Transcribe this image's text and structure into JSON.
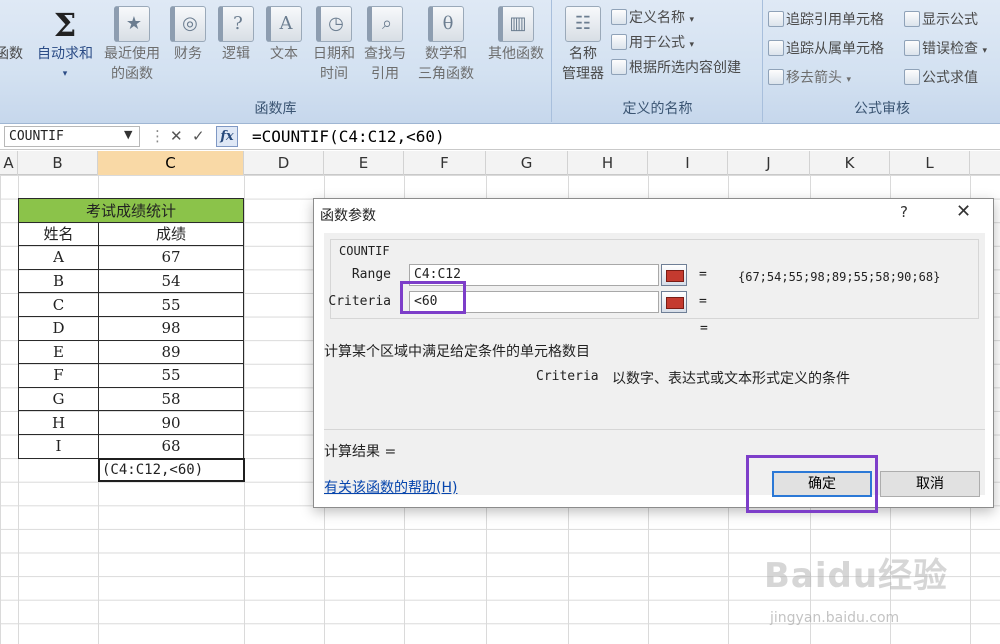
{
  "ribbon": {
    "groups": {
      "library": "函数库",
      "defined_names": "定义的名称",
      "auditing": "公式审核"
    },
    "insert_function_partial": "函数",
    "autosum": {
      "icon_glyph": "Σ",
      "label": "自动求和"
    },
    "recent": {
      "line1": "最近使用",
      "line2": "的函数"
    },
    "financial": "财务",
    "logical": "逻辑",
    "text": "文本",
    "datetime": {
      "line1": "日期和",
      "line2": "时间"
    },
    "lookup": {
      "line1": "查找与",
      "line2": "引用"
    },
    "math": {
      "line1": "数学和",
      "line2": "三角函数"
    },
    "more": "其他函数",
    "name_manager": {
      "line1": "名称",
      "line2": "管理器"
    },
    "define_name": "定义名称",
    "use_in_formula": "用于公式",
    "create_from_selection": "根据所选内容创建",
    "trace_precedents": "追踪引用单元格",
    "trace_dependents": "追踪从属单元格",
    "remove_arrows": "移去箭头",
    "show_formulas": "显示公式",
    "error_checking": "错误检查",
    "evaluate_formula": "公式求值"
  },
  "formula_bar": {
    "name_box": "COUNTIF",
    "formula": "=COUNTIF(C4:C12,<60)"
  },
  "columns": [
    "A",
    "B",
    "C",
    "D",
    "E",
    "F",
    "G",
    "H",
    "I",
    "J",
    "K",
    "L"
  ],
  "table": {
    "title": "考试成绩统计",
    "headers": [
      "姓名",
      "成绩"
    ],
    "rows": [
      [
        "A",
        "67"
      ],
      [
        "B",
        "54"
      ],
      [
        "C",
        "55"
      ],
      [
        "D",
        "98"
      ],
      [
        "E",
        "89"
      ],
      [
        "F",
        "55"
      ],
      [
        "G",
        "58"
      ],
      [
        "H",
        "90"
      ],
      [
        "I",
        "68"
      ]
    ],
    "edit_cell": "(C4:C12,<60)"
  },
  "dialog": {
    "title": "函数参数",
    "help_glyph": "?",
    "close_glyph": "✕",
    "function_name": "COUNTIF",
    "range_label": "Range",
    "range_value": "C4:C12",
    "range_result": "{67;54;55;98;89;55;58;90;68}",
    "criteria_label": "Criteria",
    "criteria_value": "<60",
    "eq": "=",
    "description": "计算某个区域中满足给定条件的单元格数目",
    "arg_desc_name": "Criteria",
    "arg_desc": "以数字、表达式或文本形式定义的条件",
    "calc_result": "计算结果 =",
    "help_link": "有关该函数的帮助(H)",
    "ok": "确定",
    "cancel": "取消"
  },
  "highlight_color": "#7d3ec9",
  "watermark": {
    "text": "Baidu经验",
    "url": "jingyan.baidu.com"
  }
}
